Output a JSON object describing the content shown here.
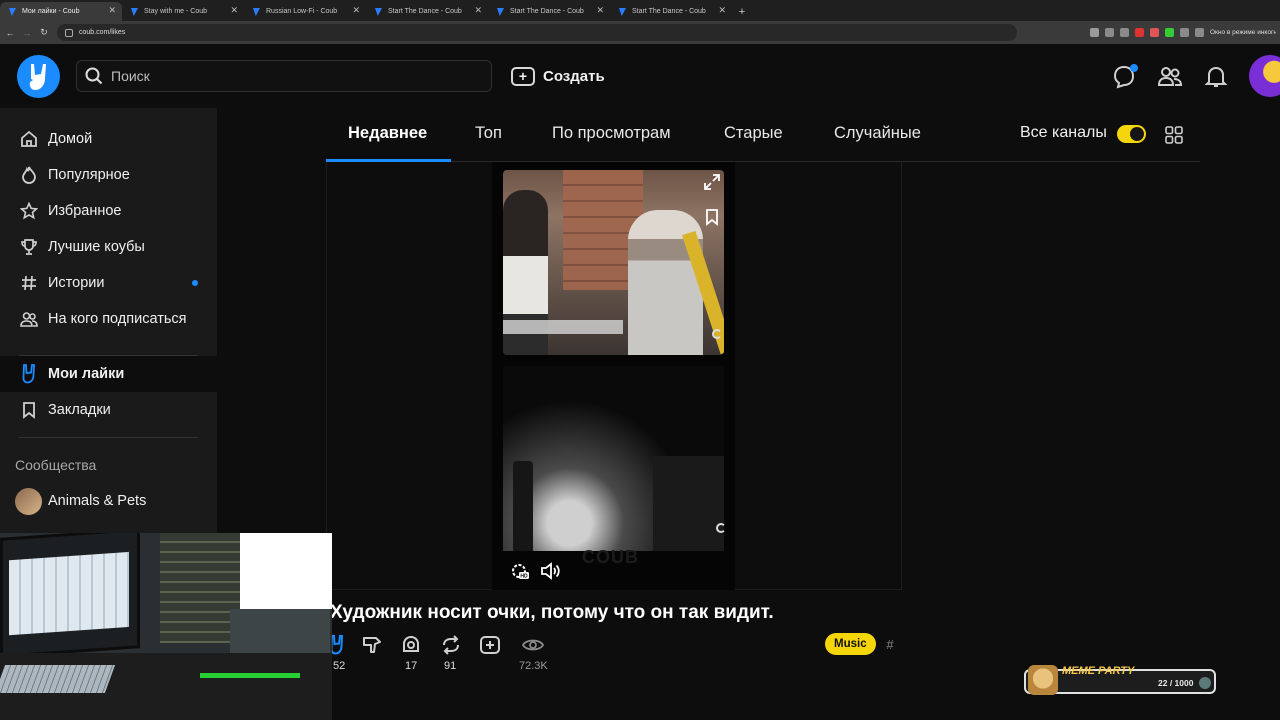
{
  "browser": {
    "tabs": [
      {
        "title": "Мои лайки - Coub",
        "active": true
      },
      {
        "title": "Stay with me - Coub",
        "active": false
      },
      {
        "title": "Russian Low-Fi - Coub",
        "active": false
      },
      {
        "title": "Start The Dance - Coub",
        "active": false
      },
      {
        "title": "Start The Dance - Coub",
        "active": false
      },
      {
        "title": "Start The Dance - Coub",
        "active": false
      }
    ],
    "url": "coub.com/likes",
    "incognito_label": "Окно в режиме инкогнито"
  },
  "header": {
    "search_placeholder": "Поиск",
    "create_label": "Создать"
  },
  "sidebar": {
    "items": [
      {
        "label": "Домой",
        "icon": "home-icon"
      },
      {
        "label": "Популярное",
        "icon": "flame-icon"
      },
      {
        "label": "Избранное",
        "icon": "star-icon"
      },
      {
        "label": "Лучшие коубы",
        "icon": "trophy-icon"
      },
      {
        "label": "Истории",
        "icon": "hashtag-icon"
      },
      {
        "label": "На кого подписаться",
        "icon": "users-icon"
      }
    ],
    "mine": [
      {
        "label": "Мои лайки",
        "icon": "rock-hand-icon",
        "active": true
      },
      {
        "label": "Закладки",
        "icon": "bookmark-icon"
      }
    ],
    "communities_heading": "Сообщества",
    "communities": [
      {
        "label": "Animals & Pets"
      }
    ]
  },
  "feed_tabs": {
    "tabs": [
      "Недавнее",
      "Топ",
      "По просмотрам",
      "Старые",
      "Случайные"
    ],
    "active_index": 0,
    "all_channels_label": "Все каналы",
    "all_channels_on": true
  },
  "coub": {
    "title": "Художник носит очки, потому что он так видит.",
    "watermark": "COUB",
    "likes": "52",
    "recoubs_count": "17",
    "reposts": "91",
    "views": "72.3K",
    "tag": "Music",
    "hash": "#"
  },
  "overlay": {
    "meme_party_label": "MEME PARTY",
    "meme_counter": "22 / 1000"
  },
  "colors": {
    "accent_blue": "#1a8cff",
    "toggle_yellow": "#f5d60a",
    "sidebar_bg": "#1a1a1a",
    "page_bg": "#0d0d0d"
  }
}
